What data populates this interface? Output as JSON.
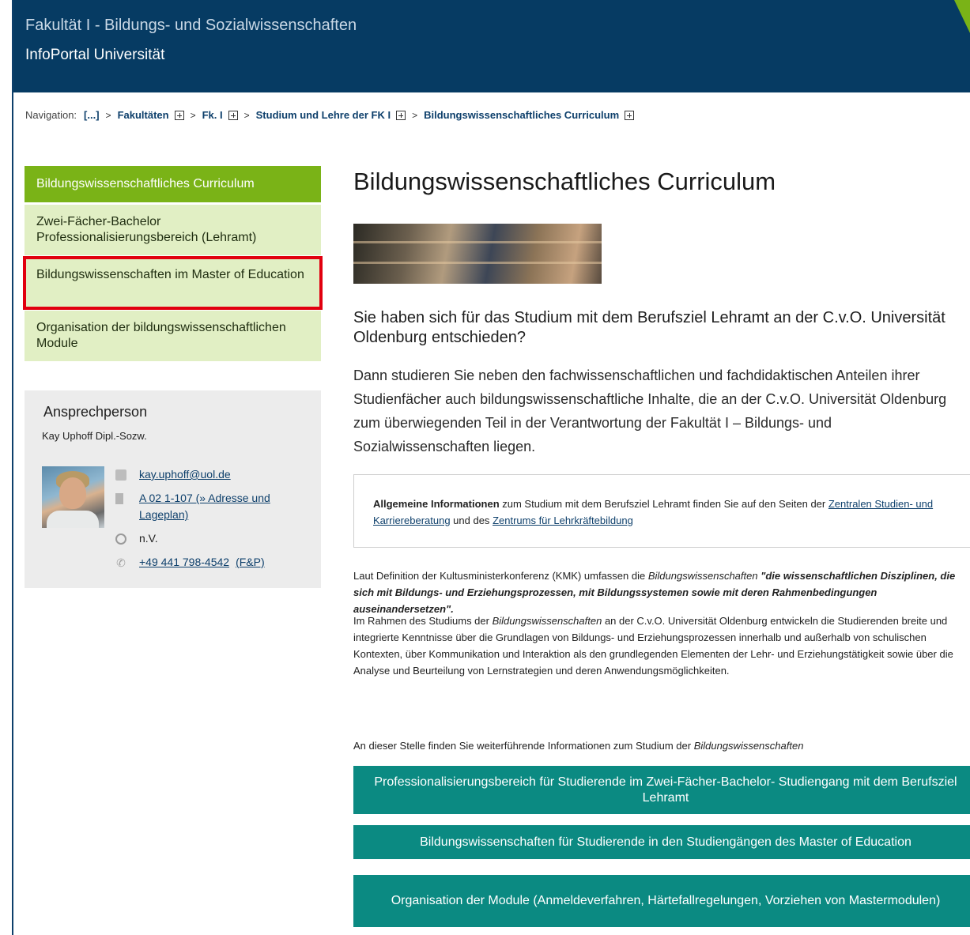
{
  "header": {
    "faculty": "Fakultät I - Bildungs- und Sozialwissenschaften",
    "portal": "InfoPortal Universität",
    "accent_color": "#7ab317",
    "background_color": "#063b63"
  },
  "breadcrumb": {
    "label": "Navigation:",
    "items": [
      "[...]",
      "Fakultäten",
      "Fk. I",
      "Studium und Lehre der FK I",
      "Bildungswissenschaftliches Curriculum"
    ],
    "expand_icon": "plus-square-icon",
    "separator": ">"
  },
  "sidenav": {
    "items": [
      {
        "label": "Bildungswissenschaftliches Curriculum",
        "active": true
      },
      {
        "label": "Zwei-Fächer-Bachelor Professionalisierungsbereich (Lehramt)"
      },
      {
        "label": "Bildungswissenschaften im Master of Education",
        "highlighted": true
      },
      {
        "label": "Organisation der bildungswissenschaftlichen Module"
      }
    ]
  },
  "contact": {
    "title": "Ansprechperson",
    "name": "Kay Uphoff Dipl.-Sozw.",
    "email": "kay.uphoff@uol.de",
    "room": "A 02 1-107 (» Adresse und Lageplan)",
    "hours": "n.V.",
    "phone": "+49 441 798-4542",
    "phone_extra": "(F&P)"
  },
  "main": {
    "title": "Bildungswissenschaftliches Curriculum",
    "lead": "Sie haben sich für das Studium mit dem Berufsziel Lehramt an der C.v.O. Universität Oldenburg entschieden?",
    "intro": "Dann studieren Sie neben den fachwissenschaftlichen und fachdidaktischen Anteilen ihrer Studienfächer auch bildungswissenschaftliche Inhalte, die an der C.v.O. Universität Oldenburg zum überwiegenden Teil in der Verantwortung der Fakultät I – Bildungs- und Sozialwissenschaften liegen.",
    "infobox": {
      "bold": "Allgemeine Informationen",
      "text1": " zum Studium mit dem Berufsziel Lehramt finden Sie auf den Seiten der ",
      "link1": "Zentralen Studien- und Karriereberatung",
      "text2": " und des ",
      "link2": "Zentrums für Lehrkräftebildung"
    },
    "p1_start": "Laut Definition der Kultusministerkonferenz (KMK) umfassen die ",
    "p1_italic": "Bildungswissenschaften",
    "p1_quote": " \"die wissenschaftlichen Disziplinen, die sich mit Bildungs- und Erziehungsprozessen, mit Bildungssystemen sowie mit deren Rahmenbedingungen auseinandersetzen\".",
    "p2_start": "Im Rahmen des Studiums der ",
    "p2_italic": "Bildungswissenschaften",
    "p2_rest": " an der C.v.O. Universität Oldenburg entwickeln die Studierenden breite und integrierte Kenntnisse über die Grundlagen von Bildungs- und Erziehungsprozessen innerhalb und außerhalb von schulischen Kontexten, über Kommunikation und Interaktion als den grundlegenden Elementen der Lehr- und Erziehungstätigkeit sowie über die Analyse und Beurteilung von Lernstrategien und deren Anwendungsmöglichkeiten.",
    "p3_start": "An dieser Stelle finden Sie weiterführende Informationen zum Studium der ",
    "p3_italic": "Bildungswissenschaften",
    "buttons": [
      "Professionalisierungsbereich für Studierende im Zwei-Fächer-Bachelor- Studiengang mit dem Berufsziel Lehramt",
      "Bildungswissenschaften für Studierende in den Studiengängen des Master of Education",
      "Organisation der Module (Anmeldeverfahren, Härtefallregelungen, Vorziehen von Mastermodulen)"
    ],
    "button_color": "#0b8a82"
  }
}
